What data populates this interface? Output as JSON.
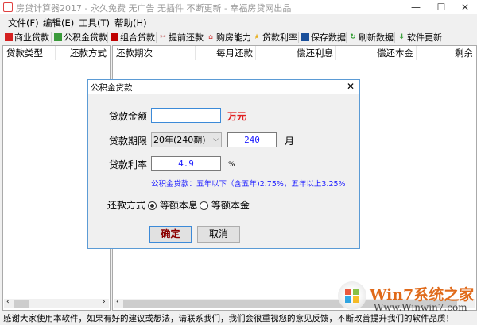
{
  "window": {
    "title": "房贷计算器2017 - 永久免费 无广告 无插件 不断更新 - 幸福房贷网出品",
    "minimize": "—",
    "maximize": "☐",
    "close": "✕"
  },
  "menu": [
    "文件(F)",
    "编辑(E)",
    "工具(T)",
    "帮助(H)"
  ],
  "toolbar": [
    {
      "label": "商业贷款",
      "icon": "bank-icon",
      "color": "#d42020"
    },
    {
      "label": "公积金贷款",
      "icon": "fund-icon",
      "color": "#3a9a3a"
    },
    {
      "label": "组合贷款",
      "icon": "combo-icon",
      "color": "#c00000"
    },
    {
      "label": "提前还款",
      "icon": "scissors-icon",
      "color": "#c06060"
    },
    {
      "label": "购房能力",
      "icon": "house-icon",
      "color": "#d03030"
    },
    {
      "label": "贷款利率",
      "icon": "star-icon",
      "color": "#e8b020"
    },
    {
      "label": "保存数据",
      "icon": "save-icon",
      "color": "#1a4f9a"
    },
    {
      "label": "刷新数据",
      "icon": "refresh-icon",
      "color": "#2a9a2a"
    },
    {
      "label": "软件更新",
      "icon": "download-icon",
      "color": "#40a040"
    }
  ],
  "left_table": {
    "columns": [
      "贷款类型",
      "还款方式"
    ]
  },
  "right_table": {
    "columns": [
      "还款期次",
      "每月还款",
      "偿还利息",
      "偿还本金",
      "剩余"
    ]
  },
  "status": "感谢大家使用本软件，如果有好的建议或想法，请联系我们，我们会很重视您的意见反馈，不断改善提升我们的软件品质！",
  "watermark": {
    "brand": "Win7系统之家",
    "url": "Www.Winwin7.com"
  },
  "dialog": {
    "title": "公积金贷款",
    "amount_label": "贷款金额",
    "amount_value": "",
    "amount_unit": "万元",
    "term_label": "贷款期限",
    "term_selected": "20年(240期)",
    "term_months": "240",
    "term_unit": "月",
    "rate_label": "贷款利率",
    "rate_value": "4.9",
    "rate_unit": "%",
    "hint": "公积金贷款：五年以下（含五年)2.75%，五年以上3.25%",
    "repay_label": "还款方式",
    "repay_options": [
      "等额本息",
      "等额本金"
    ],
    "repay_selected": 0,
    "ok": "确定",
    "cancel": "取消"
  }
}
